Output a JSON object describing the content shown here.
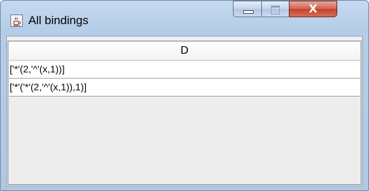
{
  "window": {
    "title": "All bindings",
    "icon": "java-cup-icon",
    "controls": {
      "minimize_icon": "minimize-icon",
      "maximize_icon": "maximize-icon",
      "close_icon": "close-icon",
      "close_glyph": "X"
    }
  },
  "table": {
    "columns": [
      "D"
    ],
    "rows": [
      [
        "['*'(2,'^'(x,1))]"
      ],
      [
        "['*'('*'(2,'^'(x,1)),1)]"
      ]
    ]
  },
  "colors": {
    "close_button": "#c2402b",
    "title_bar": "#b6cde8",
    "client_background": "#f0f0f0"
  }
}
